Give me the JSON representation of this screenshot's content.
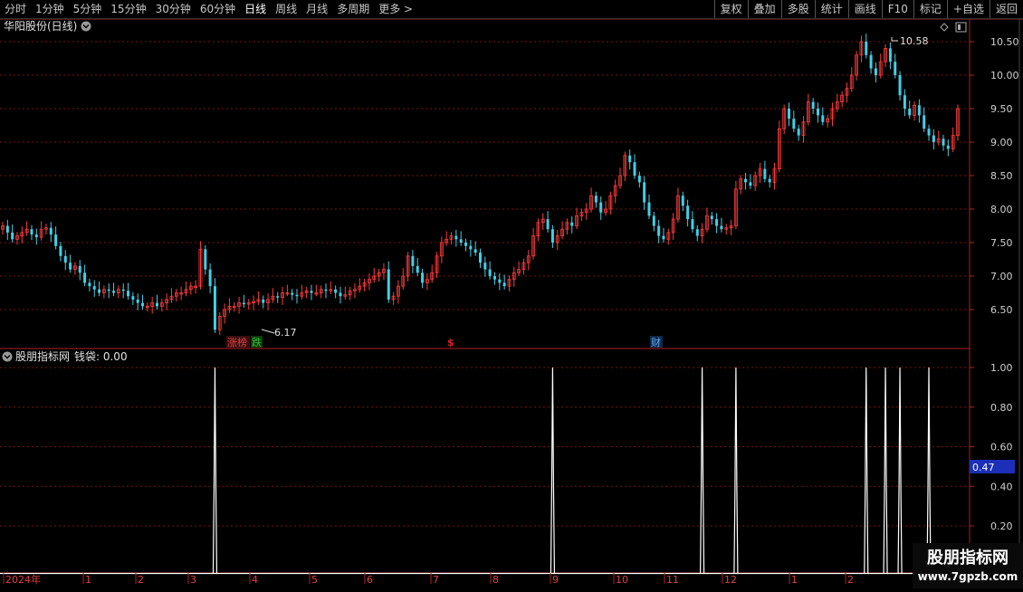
{
  "toolbar": {
    "periods": [
      "分时",
      "1分钟",
      "5分钟",
      "15分钟",
      "30分钟",
      "60分钟",
      "日线",
      "周线",
      "月线",
      "多周期",
      "更多 >"
    ],
    "active": "日线",
    "buttons": [
      "复权",
      "叠加",
      "多股",
      "统计",
      "画线",
      "F10",
      "标记",
      "+自选",
      "返回"
    ]
  },
  "price_panel": {
    "title": "华阳股份(日线)",
    "high_label": "10.58",
    "low_label": "6.17",
    "markers": [
      {
        "text": "涨榜",
        "color": "#e04040"
      },
      {
        "text": "跌",
        "color": "#30c030"
      },
      {
        "text": "$",
        "color": "#e02020"
      },
      {
        "text": "财",
        "color": "#3a8ee6"
      }
    ]
  },
  "indicator_panel": {
    "title": "股朋指标网",
    "series_label": "钱袋: 0.00",
    "axis_value_badge": "0.47"
  },
  "watermark": {
    "text": "股朋指标网",
    "url": "www.7gpzb.com"
  },
  "colors": {
    "up": "#ff3b3b",
    "down": "#40d0e8",
    "grid": "#7a1010",
    "signal": "#ffffff",
    "panel_border": "#b02020",
    "badge": "#1b2fb8"
  },
  "chart_data": [
    {
      "type": "candlestick",
      "title": "华阳股份(日线)",
      "y_ticks": [
        6.5,
        7.0,
        7.5,
        8.0,
        8.5,
        9.0,
        9.5,
        10.0,
        10.5
      ],
      "ylim": [
        6.0,
        10.75
      ],
      "x_ticks": [
        "2024年",
        "1",
        "2",
        "3",
        "4",
        "5",
        "6",
        "7",
        "8",
        "9",
        "10",
        "11",
        "12",
        "1",
        "2"
      ],
      "max_price": 10.58,
      "min_price": 6.17,
      "close_series": [
        7.75,
        7.65,
        7.55,
        7.6,
        7.65,
        7.7,
        7.62,
        7.58,
        7.7,
        7.72,
        7.62,
        7.45,
        7.3,
        7.2,
        7.1,
        7.15,
        7.05,
        6.9,
        6.85,
        6.8,
        6.75,
        6.8,
        6.78,
        6.75,
        6.8,
        6.78,
        6.7,
        6.65,
        6.6,
        6.55,
        6.55,
        6.6,
        6.55,
        6.6,
        6.65,
        6.7,
        6.75,
        6.75,
        6.8,
        6.85,
        6.85,
        7.4,
        7.1,
        6.85,
        6.2,
        6.4,
        6.5,
        6.55,
        6.55,
        6.6,
        6.58,
        6.6,
        6.62,
        6.65,
        6.6,
        6.65,
        6.7,
        6.68,
        6.75,
        6.75,
        6.72,
        6.7,
        6.75,
        6.78,
        6.75,
        6.75,
        6.8,
        6.78,
        6.8,
        6.75,
        6.7,
        6.72,
        6.78,
        6.8,
        6.85,
        6.9,
        6.95,
        7.0,
        7.05,
        7.1,
        6.65,
        6.7,
        6.85,
        7.0,
        7.3,
        7.15,
        7.05,
        6.9,
        6.95,
        7.05,
        7.3,
        7.5,
        7.55,
        7.6,
        7.55,
        7.5,
        7.45,
        7.4,
        7.35,
        7.2,
        7.1,
        7.0,
        6.95,
        6.9,
        6.85,
        6.95,
        7.05,
        7.1,
        7.2,
        7.3,
        7.6,
        7.8,
        7.85,
        7.7,
        7.5,
        7.6,
        7.7,
        7.8,
        7.75,
        7.9,
        7.95,
        8.0,
        8.2,
        8.1,
        7.95,
        8.0,
        8.2,
        8.35,
        8.5,
        8.8,
        8.7,
        8.5,
        8.4,
        8.1,
        7.9,
        7.75,
        7.6,
        7.55,
        7.65,
        7.85,
        8.2,
        8.05,
        7.85,
        7.7,
        7.6,
        7.7,
        7.9,
        7.85,
        7.75,
        7.7,
        7.72,
        7.75,
        8.3,
        8.45,
        8.4,
        8.35,
        8.5,
        8.6,
        8.45,
        8.4,
        8.6,
        9.2,
        9.5,
        9.35,
        9.2,
        9.1,
        9.3,
        9.6,
        9.5,
        9.4,
        9.3,
        9.35,
        9.5,
        9.6,
        9.7,
        9.8,
        10.0,
        10.3,
        10.5,
        10.3,
        10.1,
        10.0,
        10.2,
        10.4,
        10.2,
        10.0,
        9.7,
        9.5,
        9.4,
        9.55,
        9.4,
        9.2,
        9.1,
        9.0,
        9.05,
        8.95,
        8.9,
        9.1,
        9.5
      ]
    },
    {
      "type": "line",
      "title": "股朋指标网",
      "series": [
        {
          "name": "钱袋",
          "values": []
        }
      ],
      "y_ticks": [
        0.2,
        0.4,
        0.6,
        0.8,
        1.0
      ],
      "ylim": [
        -0.05,
        1.0
      ],
      "signal_days": [
        44,
        114,
        145,
        152,
        179,
        183,
        186,
        192
      ]
    }
  ]
}
